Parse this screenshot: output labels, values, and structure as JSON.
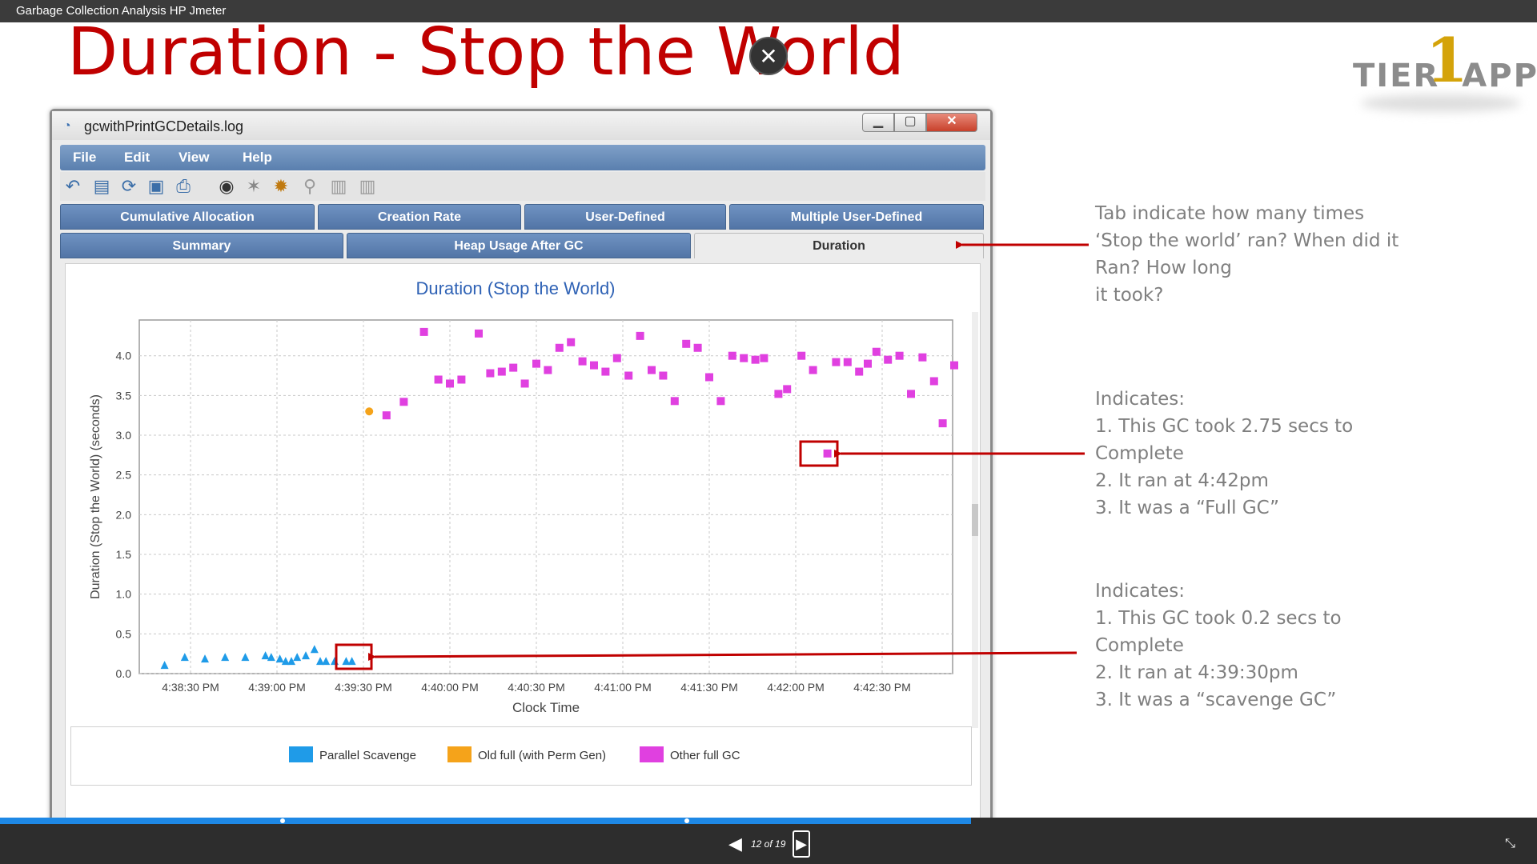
{
  "window_title": "Garbage Collection Analysis HP Jmeter",
  "slide": {
    "title": "Duration - Stop the World",
    "logo": {
      "prefix": "TIER",
      "one": "1",
      "suffix": "APP"
    },
    "app_window": {
      "title": "gcwithPrintGCDetails.log",
      "menu": [
        "File",
        "Edit",
        "View",
        "Help"
      ],
      "tabs_row1": [
        "Cumulative Allocation",
        "Creation Rate",
        "User-Defined",
        "Multiple User-Defined"
      ],
      "tabs_row2": [
        "Summary",
        "Heap Usage After GC",
        "Duration"
      ],
      "active_tab": "Duration"
    },
    "annotations": [
      {
        "lines": [
          "Tab indicate how many times",
          "‘Stop the world’ ran? When did it",
          "Ran? How long",
          "it took?"
        ]
      },
      {
        "lines": [
          "Indicates:",
          "1. This GC took 2.75 secs to",
          "Complete",
          "2. It ran at 4:42pm",
          "3. It was a “Full GC”"
        ]
      },
      {
        "lines": [
          "Indicates:",
          "1. This GC took 0.2 secs to",
          "Complete",
          "2. It ran at 4:39:30pm",
          "3. It was a “scavenge GC”"
        ]
      }
    ],
    "annotation_color": "#c00000"
  },
  "chart_data": {
    "type": "scatter",
    "title": "Duration (Stop the World)",
    "xlabel": "Clock Time",
    "ylabel": "Duration (Stop the World) (seconds)",
    "x_ticks": [
      "4:38:30 PM",
      "4:39:00 PM",
      "4:39:30 PM",
      "4:40:00 PM",
      "4:40:30 PM",
      "4:41:00 PM",
      "4:41:30 PM",
      "4:42:00 PM",
      "4:42:30 PM"
    ],
    "y_ticks": [
      "0.0",
      "0.5",
      "1.0",
      "1.5",
      "2.0",
      "2.5",
      "3.0",
      "3.5",
      "4.0"
    ],
    "ylim": [
      0,
      4.45
    ],
    "grid": true,
    "legend_position": "bottom",
    "series": [
      {
        "name": "Parallel Scavenge",
        "color": "#1f9be8",
        "marker": "triangle",
        "points": [
          [
            -9,
            0.1
          ],
          [
            -2,
            0.2
          ],
          [
            5,
            0.18
          ],
          [
            12,
            0.2
          ],
          [
            19,
            0.2
          ],
          [
            26,
            0.22
          ],
          [
            28,
            0.2
          ],
          [
            31,
            0.18
          ],
          [
            33,
            0.15
          ],
          [
            35,
            0.15
          ],
          [
            37,
            0.2
          ],
          [
            40,
            0.22
          ],
          [
            43,
            0.3
          ],
          [
            45,
            0.15
          ],
          [
            47,
            0.15
          ],
          [
            50,
            0.15
          ],
          [
            54,
            0.15
          ],
          [
            56,
            0.15
          ]
        ]
      },
      {
        "name": "Old full (with Perm Gen)",
        "color": "#f5a31a",
        "marker": "circle",
        "points": [
          [
            62,
            3.3
          ]
        ]
      },
      {
        "name": "Other full GC",
        "color": "#e040e0",
        "marker": "square",
        "points": [
          [
            68,
            3.25
          ],
          [
            74,
            3.42
          ],
          [
            81,
            4.3
          ],
          [
            86,
            3.7
          ],
          [
            90,
            3.65
          ],
          [
            94,
            3.7
          ],
          [
            100,
            4.28
          ],
          [
            104,
            3.78
          ],
          [
            108,
            3.8
          ],
          [
            112,
            3.85
          ],
          [
            116,
            3.65
          ],
          [
            120,
            3.9
          ],
          [
            124,
            3.82
          ],
          [
            128,
            4.1
          ],
          [
            132,
            4.17
          ],
          [
            136,
            3.93
          ],
          [
            140,
            3.88
          ],
          [
            144,
            3.8
          ],
          [
            148,
            3.97
          ],
          [
            152,
            3.75
          ],
          [
            156,
            4.25
          ],
          [
            160,
            3.82
          ],
          [
            164,
            3.75
          ],
          [
            168,
            3.43
          ],
          [
            172,
            4.15
          ],
          [
            176,
            4.1
          ],
          [
            180,
            3.73
          ],
          [
            184,
            3.43
          ],
          [
            188,
            4.0
          ],
          [
            192,
            3.97
          ],
          [
            196,
            3.95
          ],
          [
            199,
            3.97
          ],
          [
            204,
            3.52
          ],
          [
            207,
            3.58
          ],
          [
            212,
            4.0
          ],
          [
            216,
            3.82
          ],
          [
            221,
            2.77
          ],
          [
            224,
            3.92
          ],
          [
            228,
            3.92
          ],
          [
            232,
            3.8
          ],
          [
            235,
            3.9
          ],
          [
            238,
            4.05
          ],
          [
            242,
            3.95
          ],
          [
            246,
            4.0
          ],
          [
            250,
            3.52
          ],
          [
            254,
            3.98
          ],
          [
            258,
            3.68
          ],
          [
            261,
            3.15
          ],
          [
            265,
            3.88
          ]
        ]
      }
    ]
  },
  "player": {
    "prev_label": "◀",
    "page_counter": "12 of 19",
    "next_label": "▶",
    "progress_fraction": 0.632,
    "markers_fraction": [
      0.184,
      0.447
    ]
  }
}
